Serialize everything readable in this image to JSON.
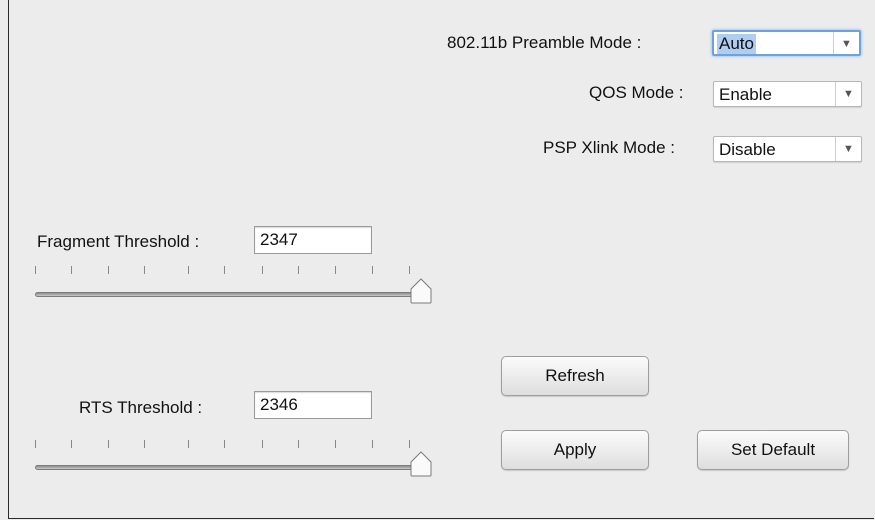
{
  "wireless_advanced": {
    "preamble": {
      "label": "802.11b  Preamble Mode :",
      "value": "Auto"
    },
    "qos": {
      "label": "QOS Mode :",
      "value": "Enable"
    },
    "psp": {
      "label": "PSP Xlink Mode :",
      "value": "Disable"
    },
    "fragment": {
      "label": "Fragment Threshold :",
      "value": "2347",
      "slider_fraction": 1.0
    },
    "rts": {
      "label": "RTS Threshold :",
      "value": "2346",
      "slider_fraction": 1.0
    },
    "buttons": {
      "refresh": "Refresh",
      "apply": "Apply",
      "set_default": "Set Default"
    },
    "icons": {
      "dropdown": "chevron-down-icon",
      "slider_thumb": "slider-thumb"
    },
    "colors": {
      "background": "#ececec",
      "focus": "#6aa3e0",
      "selection": "#aecdf1"
    }
  }
}
